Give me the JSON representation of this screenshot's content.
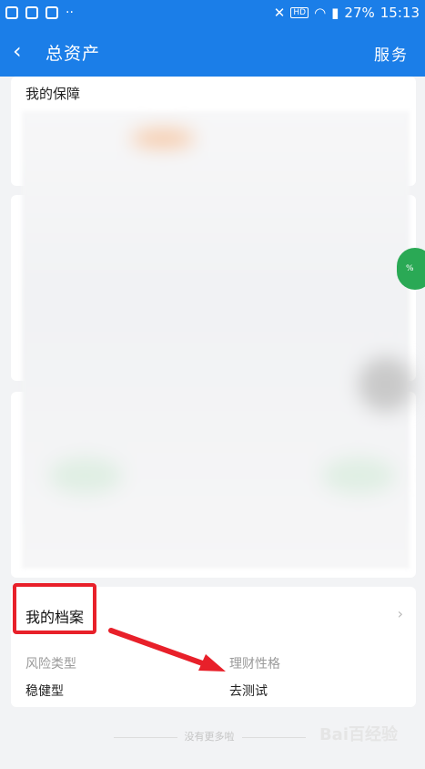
{
  "statusbar": {
    "battery": "27%",
    "time": "15:13",
    "hd": "HD"
  },
  "navbar": {
    "back": "<",
    "title": "总资产",
    "right": "服务"
  },
  "sections": {
    "protection": "我的保障"
  },
  "archive": {
    "title": "我的档案",
    "chevron": "›",
    "items": [
      {
        "label": "风险类型",
        "value": "稳健型"
      },
      {
        "label": "理财性格",
        "value": "去测试"
      }
    ]
  },
  "footer": {
    "no_more": "没有更多啦"
  },
  "watermark": "Bai百经验",
  "colors": {
    "primary": "#1b7ee8",
    "annotation": "#e8202a",
    "green": "#2aa955"
  },
  "icons": [
    "back-icon",
    "chevron-right-icon",
    "mute-icon",
    "wifi-icon",
    "signal-icon",
    "battery-icon"
  ]
}
